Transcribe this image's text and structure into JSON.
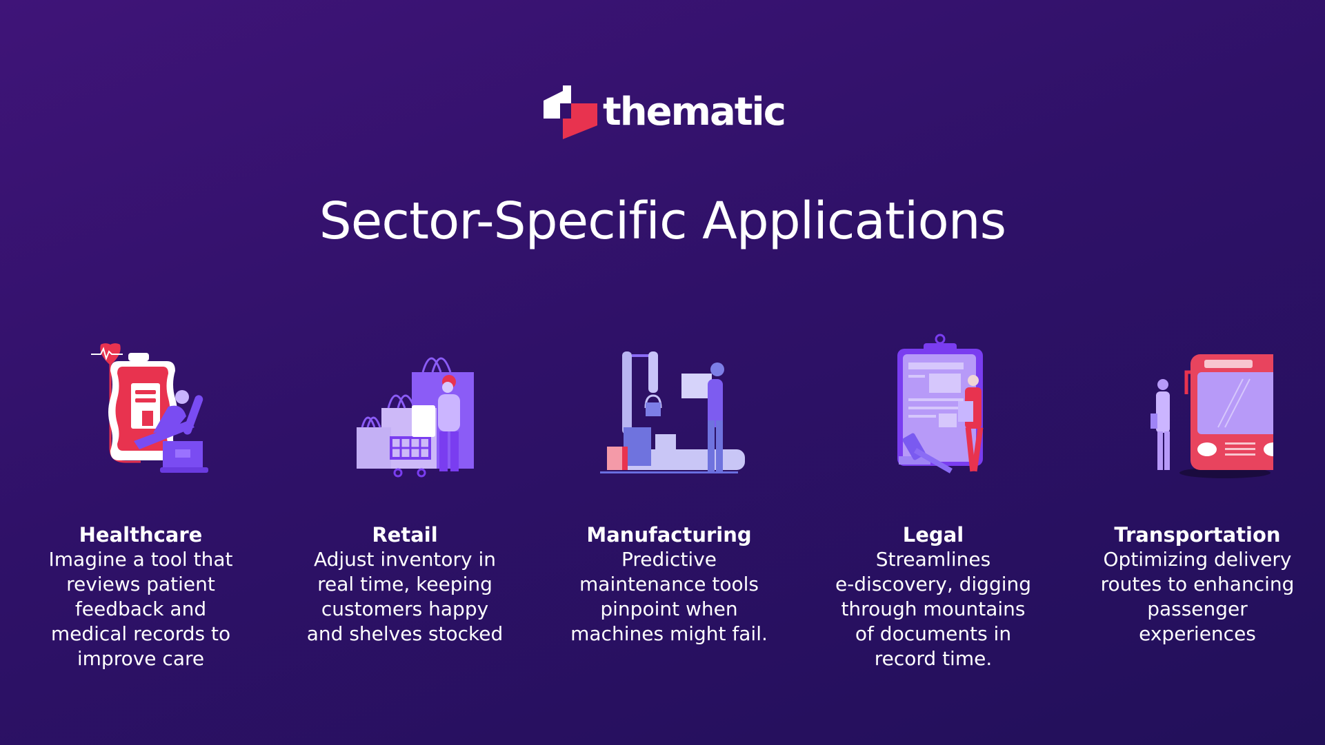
{
  "brand": {
    "name": "thematic",
    "logo_icon": "thematic-logo-icon",
    "colors": {
      "accent": "#e8334f",
      "text": "#ffffff",
      "background": "#32106b"
    }
  },
  "title": "Sector-Specific Applications",
  "sectors": [
    {
      "heading": "Healthcare",
      "icon": "blood-bag-patient-chair-icon",
      "lines": [
        "Imagine a tool that",
        "reviews patient",
        "feedback and",
        "medical records to",
        "improve care"
      ]
    },
    {
      "heading": "Retail",
      "icon": "shopping-bags-cart-icon",
      "lines": [
        "Adjust inventory in",
        "real time, keeping",
        "customers happy",
        "and shelves stocked"
      ]
    },
    {
      "heading": "Manufacturing",
      "icon": "robot-arm-boxes-worker-icon",
      "lines": [
        "Predictive",
        "maintenance tools",
        "pinpoint when",
        "machines might fail."
      ]
    },
    {
      "heading": "Legal",
      "icon": "clipboard-gavel-lawyer-icon",
      "lines": [
        "Streamlines",
        "e-discovery, digging",
        "through mountains",
        "of documents in",
        "record time."
      ]
    },
    {
      "heading": "Transportation",
      "icon": "bus-passenger-icon",
      "lines": [
        "Optimizing delivery",
        "routes to enhancing",
        "passenger",
        "experiences"
      ]
    }
  ]
}
